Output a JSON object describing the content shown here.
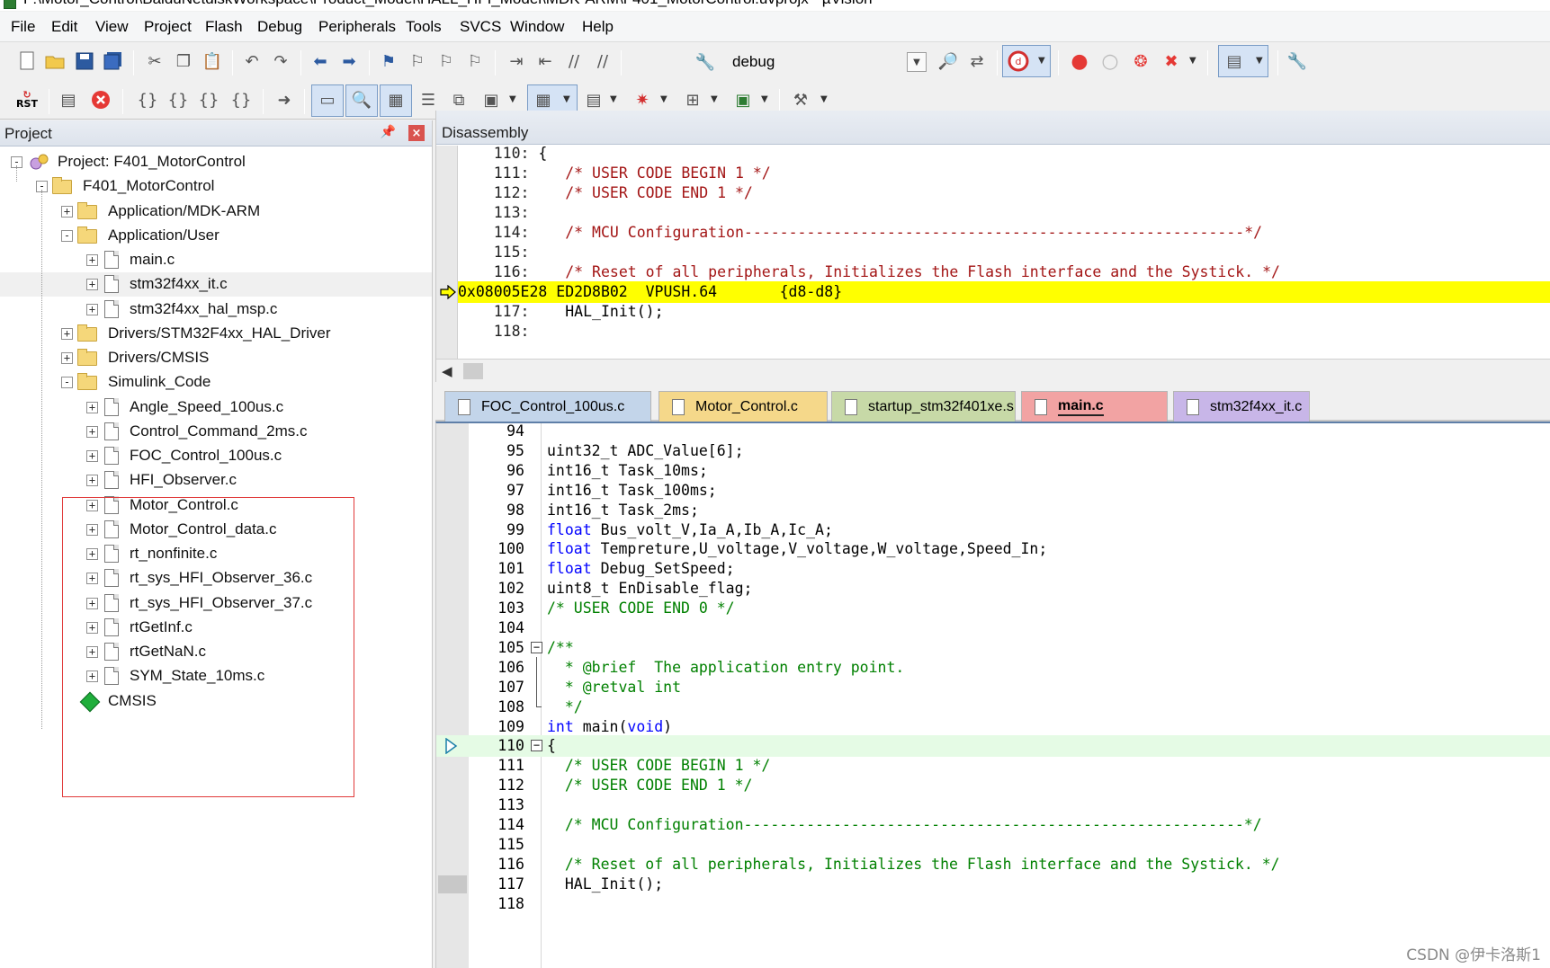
{
  "window": {
    "title": "F:\\Motor_Control\\BaiduNetdiskWorkspace\\Product_Model\\HALL_HFI_Model\\MDK-ARM\\F401_MotorControl.uvprojx - µVision"
  },
  "menubar": [
    "File",
    "Edit",
    "View",
    "Project",
    "Flash",
    "Debug",
    "Peripherals",
    "Tools",
    "SVCS",
    "Window",
    "Help"
  ],
  "toolbar": {
    "target": "debug",
    "rst_label": "RST"
  },
  "project_panel": {
    "title": "Project",
    "root": "Project: F401_MotorControl",
    "target": "F401_MotorControl",
    "groups": [
      {
        "name": "Application/MDK-ARM",
        "files": []
      },
      {
        "name": "Application/User",
        "files": [
          "main.c",
          "stm32f4xx_it.c",
          "stm32f4xx_hal_msp.c"
        ]
      },
      {
        "name": "Drivers/STM32F4xx_HAL_Driver",
        "files": []
      },
      {
        "name": "Drivers/CMSIS",
        "files": []
      },
      {
        "name": "Simulink_Code",
        "files": [
          "Angle_Speed_100us.c",
          "Control_Command_2ms.c",
          "FOC_Control_100us.c",
          "HFI_Observer.c",
          "Motor_Control.c",
          "Motor_Control_data.c",
          "rt_nonfinite.c",
          "rt_sys_HFI_Observer_36.c",
          "rt_sys_HFI_Observer_37.c",
          "rtGetInf.c",
          "rtGetNaN.c",
          "SYM_State_10ms.c"
        ]
      }
    ],
    "cmsis": "CMSIS"
  },
  "disassembly": {
    "title": "Disassembly",
    "lines": [
      {
        "ln": "110:",
        "text": " {"
      },
      {
        "ln": "111:",
        "text": "    /* USER CODE BEGIN 1 */"
      },
      {
        "ln": "112:",
        "text": "    /* USER CODE END 1 */"
      },
      {
        "ln": "113:",
        "text": ""
      },
      {
        "ln": "114:",
        "text": "    /* MCU Configuration--------------------------------------------------------*/"
      },
      {
        "ln": "115:",
        "text": ""
      },
      {
        "ln": "116:",
        "text": "    /* Reset of all peripherals, Initializes the Flash interface and the Systick. */"
      },
      {
        "ln": "",
        "text": "0x08005E28 ED2D8B02  VPUSH.64       {d8-d8}"
      },
      {
        "ln": "117:",
        "text": "    HAL_Init();"
      },
      {
        "ln": "118:",
        "text": ""
      }
    ]
  },
  "tabs": [
    {
      "label": "FOC_Control_100us.c",
      "color": "#c3d5ea"
    },
    {
      "label": "Motor_Control.c",
      "color": "#f5d88a"
    },
    {
      "label": "startup_stm32f401xe.s",
      "color": "#c7d9a7"
    },
    {
      "label": "main.c",
      "color": "#f2a3a3"
    },
    {
      "label": "stm32f4xx_it.c",
      "color": "#c8b6e8"
    }
  ],
  "editor": {
    "lines": [
      {
        "n": "94",
        "parts": []
      },
      {
        "n": "95",
        "parts": [
          [
            "",
            "uint32_t ADC_Value[6];"
          ]
        ]
      },
      {
        "n": "96",
        "parts": [
          [
            "",
            "int16_t Task_10ms;"
          ]
        ]
      },
      {
        "n": "97",
        "parts": [
          [
            "",
            "int16_t Task_100ms;"
          ]
        ]
      },
      {
        "n": "98",
        "parts": [
          [
            "",
            "int16_t Task_2ms;"
          ]
        ]
      },
      {
        "n": "99",
        "parts": [
          [
            "kw",
            "float"
          ],
          [
            "",
            " Bus_volt_V,Ia_A,Ib_A,Ic_A;"
          ]
        ]
      },
      {
        "n": "100",
        "parts": [
          [
            "kw",
            "float"
          ],
          [
            "",
            " Tempreture,U_voltage,V_voltage,W_voltage,Speed_In;"
          ]
        ]
      },
      {
        "n": "101",
        "parts": [
          [
            "kw",
            "float"
          ],
          [
            "",
            " Debug_SetSpeed;"
          ]
        ]
      },
      {
        "n": "102",
        "parts": [
          [
            "",
            "uint8_t EnDisable_flag;"
          ]
        ]
      },
      {
        "n": "103",
        "parts": [
          [
            "cmt",
            "/* USER CODE END 0 */"
          ]
        ]
      },
      {
        "n": "104",
        "parts": []
      },
      {
        "n": "105",
        "parts": [
          [
            "cmt",
            "/**"
          ]
        ]
      },
      {
        "n": "106",
        "parts": [
          [
            "cmt",
            "  * @brief  The application entry point."
          ]
        ]
      },
      {
        "n": "107",
        "parts": [
          [
            "cmt",
            "  * @retval int"
          ]
        ]
      },
      {
        "n": "108",
        "parts": [
          [
            "cmt",
            "  */"
          ]
        ]
      },
      {
        "n": "109",
        "parts": [
          [
            "kw",
            "int"
          ],
          [
            "",
            " main("
          ],
          [
            "kw",
            "void"
          ],
          [
            "",
            ")"
          ]
        ]
      },
      {
        "n": "110",
        "parts": [
          [
            "",
            "{"
          ]
        ]
      },
      {
        "n": "111",
        "parts": [
          [
            "cmt",
            "  /* USER CODE BEGIN 1 */"
          ]
        ]
      },
      {
        "n": "112",
        "parts": [
          [
            "cmt",
            "  /* USER CODE END 1 */"
          ]
        ]
      },
      {
        "n": "113",
        "parts": []
      },
      {
        "n": "114",
        "parts": [
          [
            "cmt",
            "  /* MCU Configuration--------------------------------------------------------*/"
          ]
        ]
      },
      {
        "n": "115",
        "parts": []
      },
      {
        "n": "116",
        "parts": [
          [
            "cmt",
            "  /* Reset of all peripherals, Initializes the Flash interface and the Systick. */"
          ]
        ]
      },
      {
        "n": "117",
        "parts": [
          [
            "",
            "  HAL_Init();"
          ]
        ]
      },
      {
        "n": "118",
        "parts": []
      }
    ]
  },
  "watermark": "CSDN @伊卡洛斯1"
}
